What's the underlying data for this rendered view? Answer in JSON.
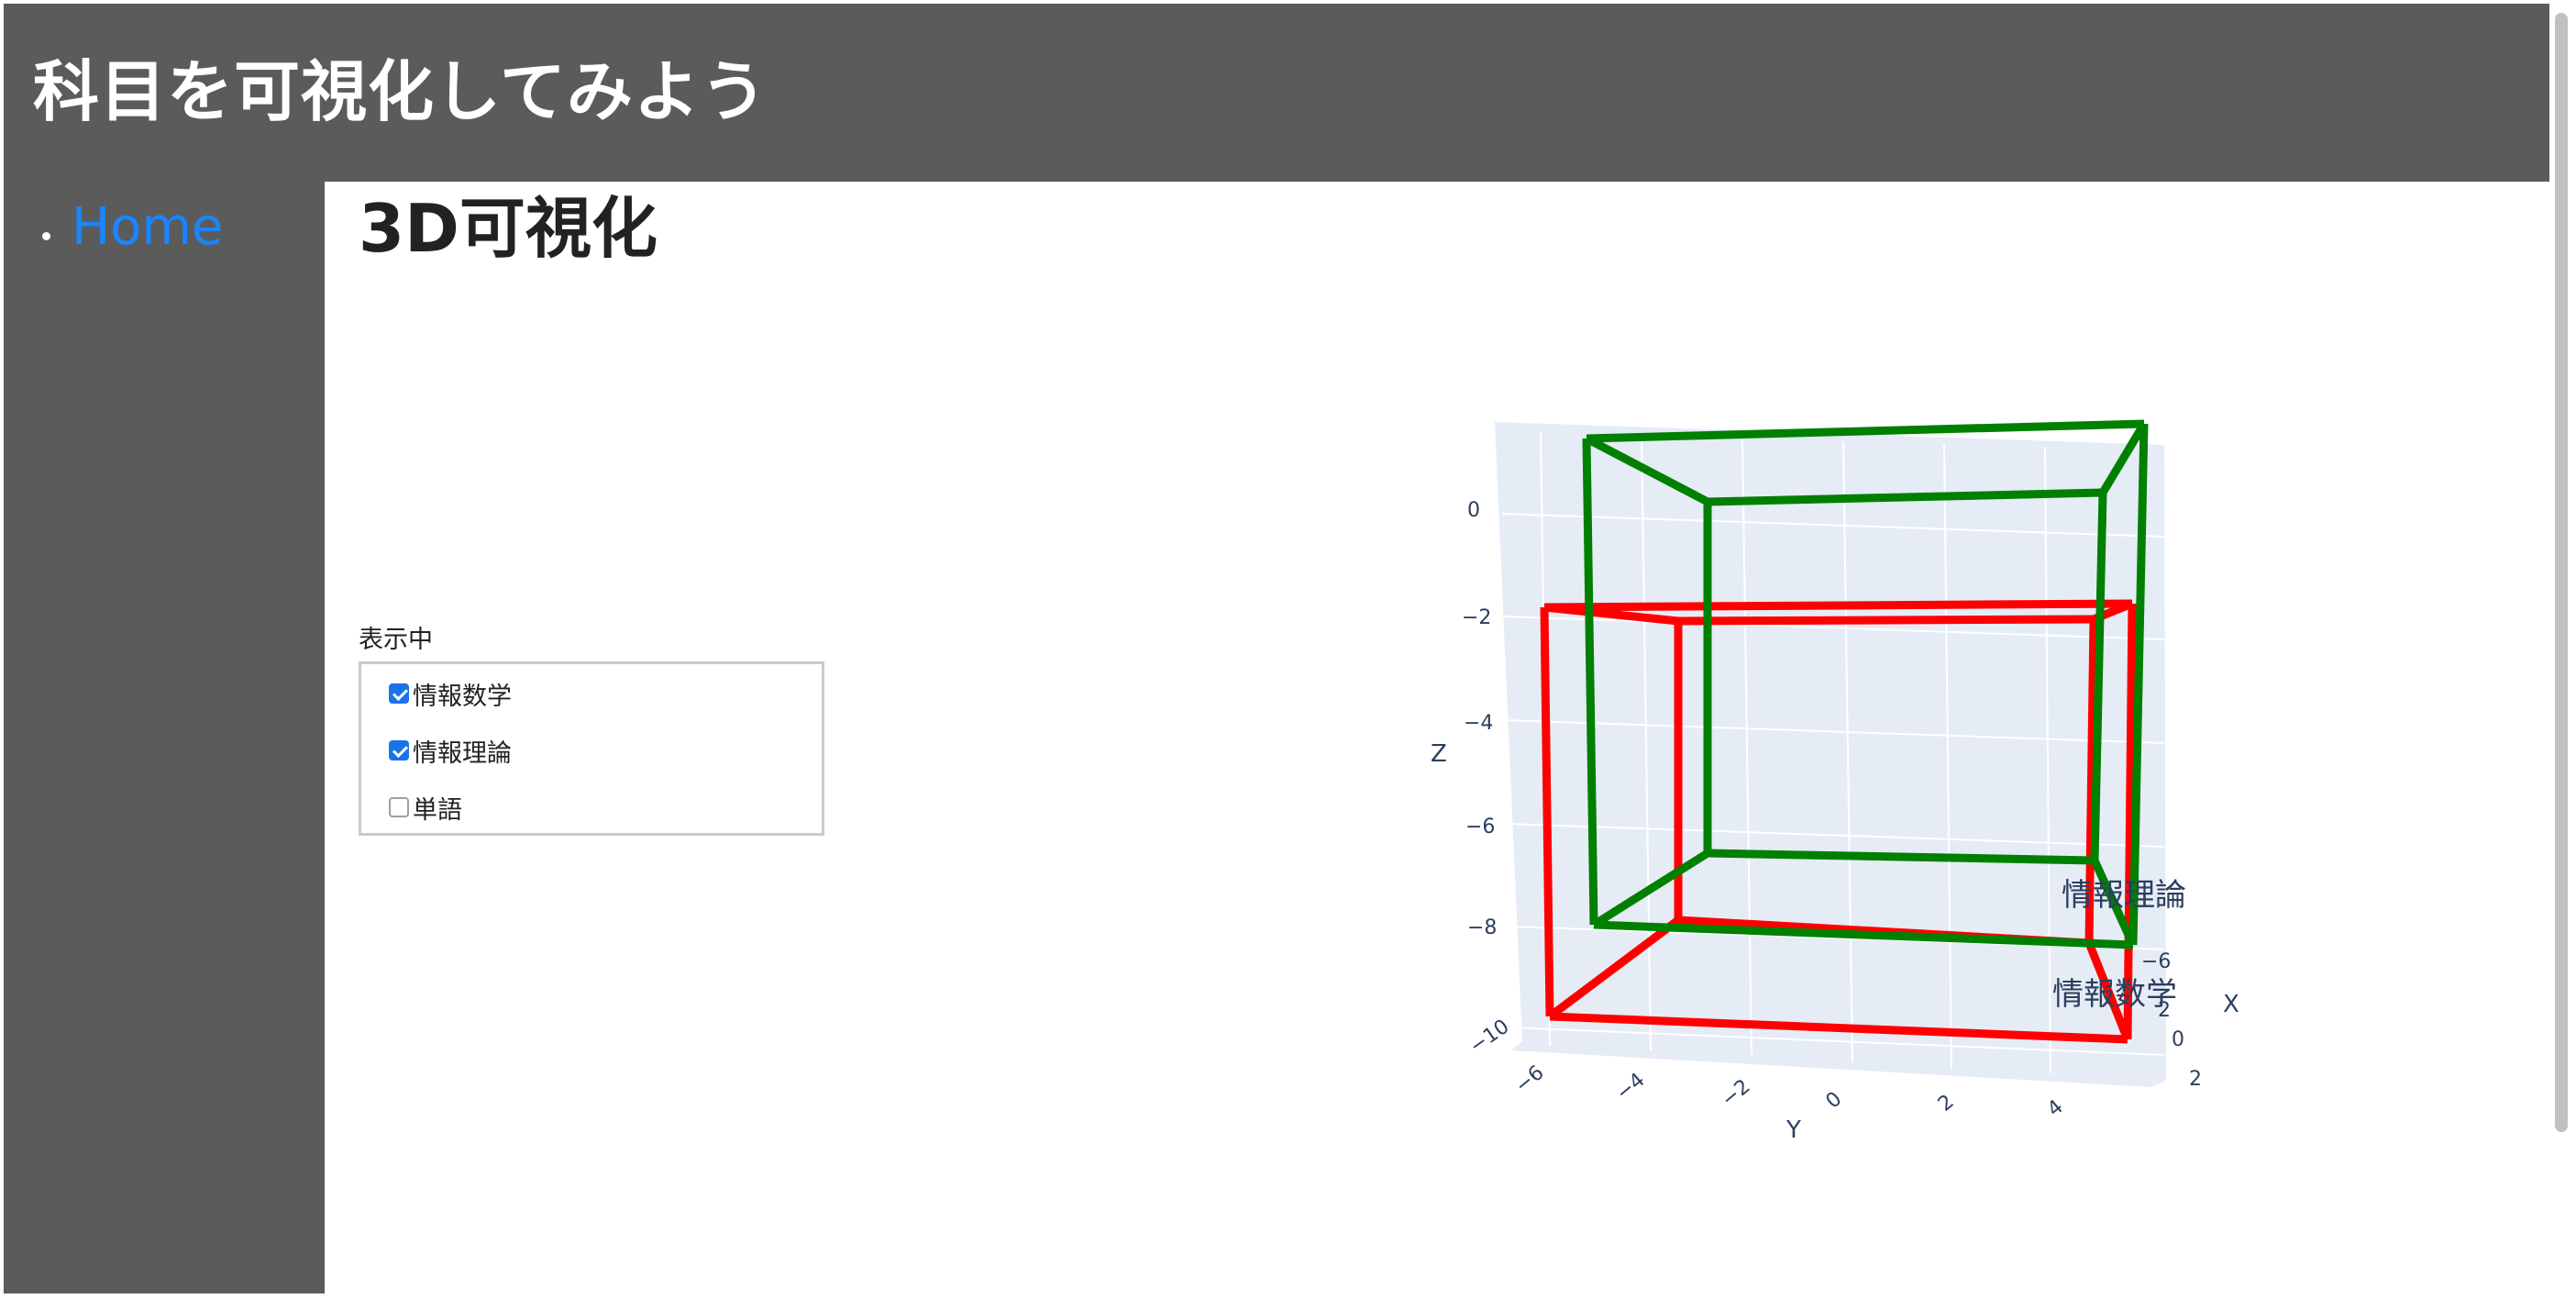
{
  "header": {
    "title": "科目を可視化してみよう"
  },
  "sidebar": {
    "items": [
      {
        "label": "Home"
      }
    ]
  },
  "main": {
    "page_title": "3D可視化",
    "filter": {
      "label": "表示中",
      "options": [
        {
          "label": "情報数学",
          "checked": true
        },
        {
          "label": "情報理論",
          "checked": true
        },
        {
          "label": "単語",
          "checked": false
        }
      ]
    }
  },
  "colors": {
    "header_bg": "#5b5b5b",
    "link": "#1a85ff",
    "box_red": "#ff0000",
    "box_green": "#008000",
    "plot_pane": "#e5ecf6",
    "axis_text": "#2a3f5f"
  },
  "chart_data": {
    "type": "3d-wireframe",
    "axes": {
      "x": {
        "label": "X",
        "ticks": [
          "−6",
          "2",
          "0",
          "2"
        ]
      },
      "y": {
        "label": "Y",
        "ticks": [
          "−6",
          "−4",
          "−2",
          "0",
          "2",
          "4"
        ]
      },
      "z": {
        "label": "Z",
        "ticks": [
          "0",
          "−2",
          "−4",
          "−6",
          "−8",
          "−10"
        ]
      }
    },
    "series": [
      {
        "name": "情報数学",
        "color": "#ff0000"
      },
      {
        "name": "情報理論",
        "color": "#008000"
      }
    ]
  }
}
